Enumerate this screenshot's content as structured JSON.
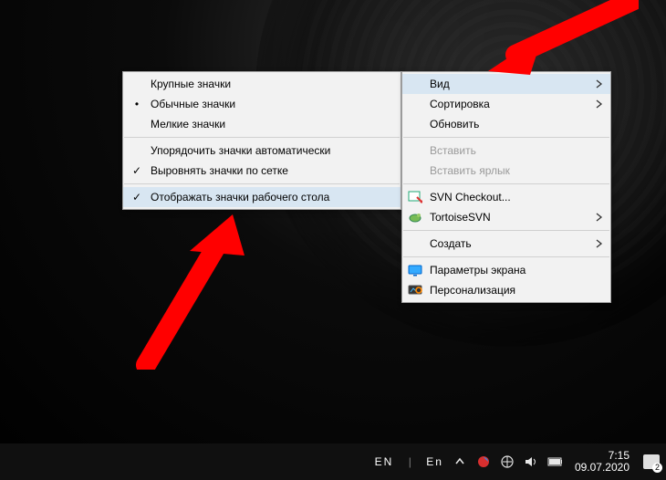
{
  "submenu": {
    "items": [
      {
        "label": "Крупные значки",
        "mark": "",
        "interact": true
      },
      {
        "label": "Обычные значки",
        "mark": "•",
        "interact": true
      },
      {
        "label": "Мелкие значки",
        "mark": "",
        "interact": true
      }
    ],
    "items2": [
      {
        "label": "Упорядочить значки автоматически",
        "mark": "",
        "interact": true
      },
      {
        "label": "Выровнять значки по сетке",
        "mark": "✓",
        "interact": true
      }
    ],
    "items3": [
      {
        "label": "Отображать значки рабочего стола",
        "mark": "✓",
        "interact": true,
        "hover": true
      }
    ]
  },
  "mainmenu": {
    "g1": [
      {
        "label": "Вид",
        "submenu": true,
        "hover": true,
        "icon": ""
      },
      {
        "label": "Сортировка",
        "submenu": true,
        "icon": ""
      },
      {
        "label": "Обновить",
        "icon": ""
      }
    ],
    "g2": [
      {
        "label": "Вставить",
        "disabled": true,
        "icon": ""
      },
      {
        "label": "Вставить ярлык",
        "disabled": true,
        "icon": ""
      }
    ],
    "g3": [
      {
        "label": "SVN Checkout...",
        "icon": "svn-checkout"
      },
      {
        "label": "TortoiseSVN",
        "submenu": true,
        "icon": "tortoise"
      }
    ],
    "g4": [
      {
        "label": "Создать",
        "submenu": true,
        "icon": ""
      }
    ],
    "g5": [
      {
        "label": "Параметры экрана",
        "icon": "display"
      },
      {
        "label": "Персонализация",
        "icon": "personalize"
      }
    ]
  },
  "taskbar": {
    "lang1": "EN",
    "lang2": "En",
    "time": "7:15",
    "date": "09.07.2020",
    "notif_count": "2"
  }
}
